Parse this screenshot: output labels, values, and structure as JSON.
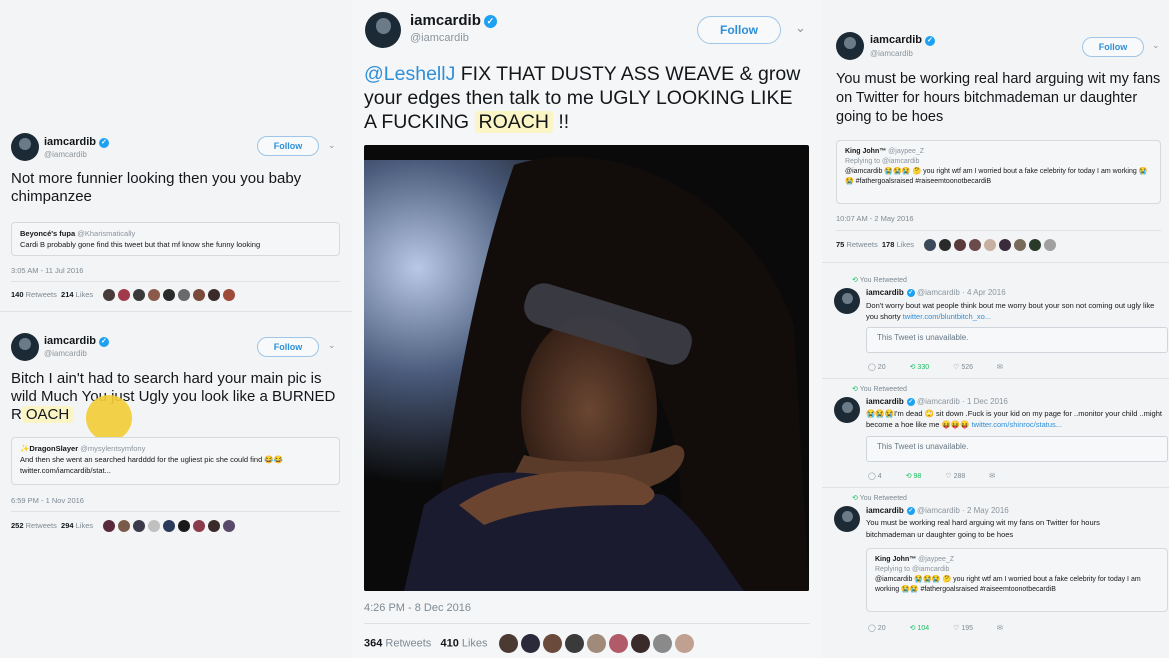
{
  "colors": {
    "verified": "#1da1f2",
    "link": "#2f8fd8",
    "highlight": "#fbf5c6",
    "cursor": "#f2cd3a"
  },
  "icons": {
    "verified": "verified-badge-icon",
    "chevron": "chevron-down-icon",
    "reply": "reply-icon",
    "retweet": "retweet-icon",
    "like": "heart-icon",
    "dm": "envelope-icon"
  },
  "left": {
    "tweet1": {
      "name": "iamcardib",
      "handle": "@iamcardib",
      "follow": "Follow",
      "text": "Not more funnier looking then you you baby chimpanzee",
      "quote": {
        "name": "Beyoncé's fupa",
        "handle": "@Kharismatically",
        "text": "Cardi B probably gone find this tweet but that mf know she funny looking"
      },
      "time": "3:05 AM - 11 Jul 2016",
      "retweets": "140",
      "retweets_label": "Retweets",
      "likes": "214",
      "likes_label": "Likes"
    },
    "tweet2": {
      "name": "iamcardib",
      "handle": "@iamcardib",
      "follow": "Follow",
      "text_a": "Bitch I ain't had to search hard your main pic is wild Much ",
      "text_b": "You just Ugly you look like a BURNED R",
      "text_c": "OACH",
      "quote": {
        "name": "✨DragonSlayer",
        "handle": "@mysylentsymfony",
        "text": "And then she went an searched hardddd for the ugliest pic she could find 😂😂",
        "link": "twitter.com/iamcardib/stat..."
      },
      "time": "6:59 PM - 1 Nov 2016",
      "retweets": "252",
      "retweets_label": "Retweets",
      "likes": "294",
      "likes_label": "Likes"
    }
  },
  "center": {
    "name": "iamcardib",
    "handle": "@iamcardib",
    "follow": "Follow",
    "mention": "@LeshellJ",
    "text": " FIX THAT DUSTY ASS WEAVE & grow your edges then talk to me UGLY LOOKING LIKE A FUCKING ",
    "highlight": "ROACH",
    "text_end": " !!",
    "time": "4:26 PM - 8 Dec 2016",
    "retweets": "364",
    "retweets_label": "Retweets",
    "likes": "410",
    "likes_label": "Likes"
  },
  "right": {
    "main": {
      "name": "iamcardib",
      "handle": "@iamcardib",
      "follow": "Follow",
      "text": "You must be working real hard arguing wit my fans on Twitter for hours bitchmademan ur daughter going to be hoes",
      "quote": {
        "name": "King John™",
        "handle": "@jaypee_Z",
        "reply": "Replying to @iamcardib",
        "text": "@iamcardib 😭😭😭 🤔 you right wtf am I worried bout a fake celebrity for today I am working 😭😭 #fathergoalsraised #raiseemtoonotbecardiB"
      },
      "time": "10:07 AM - 2 May 2016",
      "retweets": "75",
      "retweets_label": "Retweets",
      "likes": "178",
      "likes_label": "Likes"
    },
    "rt1": {
      "label": "You Retweeted",
      "name": "iamcardib",
      "handle": "@iamcardib · 4 Apr 2016",
      "text": "Don't worry bout wat people think bout me worry bout your son not coming out ugly like you shorty ",
      "link": "twitter.com/bluntbitch_xo...",
      "unavailable": "This Tweet is unavailable.",
      "replies": "20",
      "retweets": "330",
      "likes": "526"
    },
    "rt2": {
      "label": "You Retweeted",
      "name": "iamcardib",
      "handle": "@iamcardib · 1 Dec 2016",
      "text": "😭😭😭I'm dead 🙄 sit down .Fuck is your kid on my page for ..monitor your child ..might become a hoe like me 😝😝😝 ",
      "link": "twitter.com/shinroc/status...",
      "unavailable": "This Tweet is unavailable.",
      "replies": "4",
      "retweets": "98",
      "likes": "288"
    },
    "rt3": {
      "label": "You Retweeted",
      "name": "iamcardib",
      "handle": "@iamcardib · 2 May 2016",
      "text": "You must be working real hard arguing wit my fans on Twitter for hours bitchmademan ur daughter going to be hoes",
      "quote": {
        "name": "King John™",
        "handle": "@jaypee_Z",
        "reply": "Replying to @iamcardib",
        "text": "@iamcardib 😭😭😭 🤔 you right wtf am I worried bout a fake celebrity for today I am working 😭😭 #fathergoalsraised #raiseemtoonotbecardiB"
      },
      "replies": "20",
      "retweets": "104",
      "likes": "195"
    }
  }
}
